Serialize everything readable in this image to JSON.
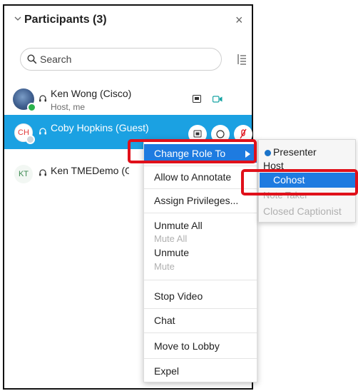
{
  "panel": {
    "title": "Participants (3)",
    "close_symbol": "×"
  },
  "search": {
    "placeholder": "Search"
  },
  "participants": [
    {
      "name": "Ken Wong (Cisco)",
      "subtitle": "Host, me",
      "avatar_initials": ""
    },
    {
      "name": "Coby Hopkins (Guest)",
      "subtitle": "",
      "avatar_initials": "CH"
    },
    {
      "name": "Ken TMEDemo (Gue",
      "subtitle": "",
      "avatar_initials": "KT"
    }
  ],
  "context_menu": {
    "items": [
      {
        "label": "Change Role To",
        "enabled": true,
        "highlighted": true,
        "has_submenu": true
      },
      {
        "label": "Allow to Annotate",
        "enabled": true
      },
      {
        "label": "Assign Privileges...",
        "enabled": true
      },
      {
        "label": "Unmute All",
        "enabled": true
      },
      {
        "label": "Mute All",
        "enabled": false
      },
      {
        "label": "Unmute",
        "enabled": true
      },
      {
        "label": "Mute",
        "enabled": false
      },
      {
        "label": "Stop Video",
        "enabled": true
      },
      {
        "label": "Chat",
        "enabled": true
      },
      {
        "label": "Move to Lobby",
        "enabled": true
      },
      {
        "label": "Expel",
        "enabled": true
      }
    ]
  },
  "role_submenu": {
    "items": [
      {
        "label": "Presenter",
        "enabled": true,
        "current": true
      },
      {
        "label": "Host",
        "enabled": true
      },
      {
        "label": "Cohost",
        "enabled": true,
        "highlighted": true
      },
      {
        "label": "Note Taker",
        "enabled": false
      },
      {
        "label": "Closed Captionist",
        "enabled": false
      }
    ]
  },
  "colors": {
    "selected_row": "#1ba1e2",
    "menu_highlight": "#1e7be0",
    "annotation_box": "#e0101a"
  },
  "icons": [
    "chevron-down-icon",
    "close-icon",
    "search-icon",
    "sort-icon",
    "headset-icon",
    "share-screen-icon",
    "video-icon",
    "mute-icon"
  ]
}
